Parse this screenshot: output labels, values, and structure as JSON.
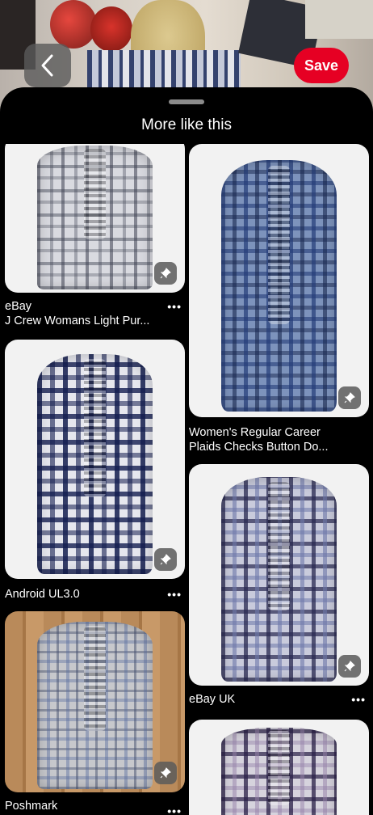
{
  "header": {
    "save_label": "Save"
  },
  "sheet": {
    "title": "More like this"
  },
  "pins": [
    {
      "id": "p1",
      "title_line1": "eBay",
      "title_line2": "J Crew Womans Light Pur..."
    },
    {
      "id": "p2",
      "title_line1": "Women's Regular Career",
      "title_line2": "Plaids Checks Button Do..."
    },
    {
      "id": "p3",
      "title_line1": "Android UL3.0",
      "title_line2": ""
    },
    {
      "id": "p4",
      "title_line1": "eBay UK",
      "title_line2": ""
    },
    {
      "id": "p5",
      "title_line1": "Poshmark",
      "title_line2": ""
    },
    {
      "id": "p6",
      "title_line1": "",
      "title_line2": ""
    }
  ],
  "icons": {
    "back": "chevron-left-icon",
    "pin": "pushpin-icon",
    "more": "more-dots-icon"
  },
  "colors": {
    "accent": "#e60023",
    "background": "#000000"
  }
}
